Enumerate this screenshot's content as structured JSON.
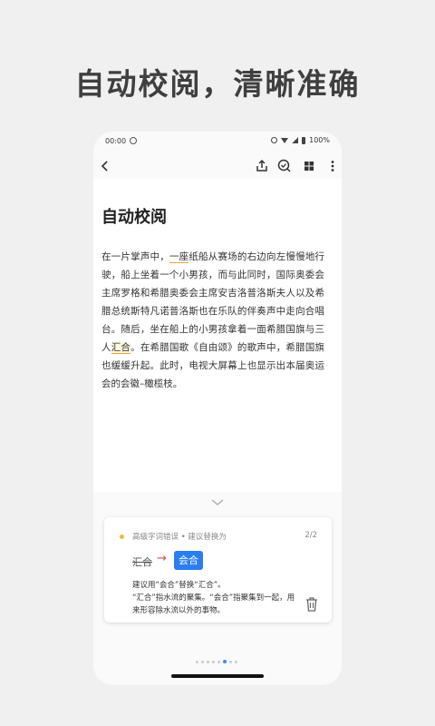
{
  "headline": "自动校阅，清晰准确",
  "status": {
    "time": "00:00",
    "battery": "100%"
  },
  "toolbar": {
    "back_icon": "back-arrow-icon",
    "share_icon": "share-icon",
    "check_icon": "proofread-icon",
    "grid_icon": "grid-icon",
    "more_icon": "more-vert-icon"
  },
  "document": {
    "title": "自动校阅",
    "segments": [
      "在一片掌声中，",
      "一座",
      "纸船从赛场的右边向左慢慢地行驶，船上坐着一个小男孩，而与此同时，国际奥委会主席罗格和希腊奥委会主席安吉洛普洛斯夫人以及希腊总统斯特凡诺普洛斯也在乐队的伴奏声中走向合唱台。随后，坐在船上的小男孩拿着一面希腊国旗与三人",
      "汇合",
      "。在希腊国歌《自由颂》的歌声中，希腊国旗也缓缓升起。此时，电视大屏幕上也显示出本届奥运会的会徽–橄榄枝。"
    ]
  },
  "card": {
    "category": "高级字词错误 • 建议替换为",
    "page": "2/2",
    "original": "汇合",
    "suggestion": "会合",
    "line1": "建议用“会合”替换“汇合”。",
    "line2": "“汇合”指水流的聚集。“会合”指聚集到一起，用来形容除水流以外的事物。"
  },
  "colors": {
    "accent": "#2a7ef0",
    "warning": "#f3b93d",
    "strike_arrow": "#d04a4a"
  },
  "pager": {
    "count": 8,
    "active_index": 5
  }
}
